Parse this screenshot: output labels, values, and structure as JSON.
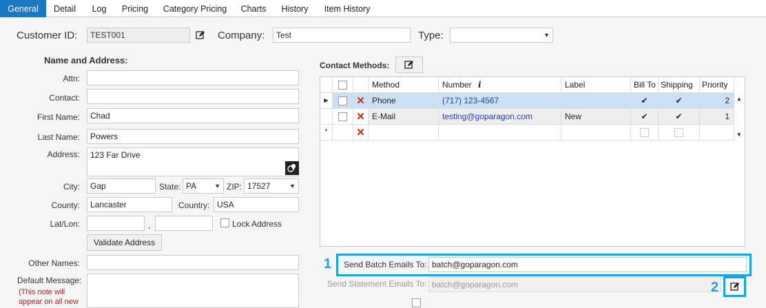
{
  "tabs": [
    "General",
    "Detail",
    "Log",
    "Pricing",
    "Category Pricing",
    "Charts",
    "History",
    "Item History"
  ],
  "header": {
    "customer_id_label": "Customer ID:",
    "customer_id_value": "TEST001",
    "company_label": "Company:",
    "company_value": "Test",
    "type_label": "Type:",
    "type_value": ""
  },
  "address": {
    "section_title": "Name and Address:",
    "attn_label": "Attn:",
    "attn_value": "",
    "contact_label": "Contact:",
    "contact_value": "",
    "first_name_label": "First Name:",
    "first_name_value": "Chad",
    "last_name_label": "Last Name:",
    "last_name_value": "Powers",
    "address_label": "Address:",
    "address_value": "123 Far Drive",
    "city_label": "City:",
    "city_value": "Gap",
    "state_label": "State:",
    "state_value": "PA",
    "zip_label": "ZIP:",
    "zip_value": "17527",
    "county_label": "County:",
    "county_value": "Lancaster",
    "country_label": "Country:",
    "country_value": "USA",
    "latlon_label": "Lat/Lon:",
    "lat_value": "",
    "latlon_separator": ",",
    "lon_value": "",
    "lock_address_label": "Lock Address",
    "validate_button": "Validate Address",
    "other_names_label": "Other Names:",
    "other_names_value": "",
    "default_message_label": "Default Message:",
    "default_message_note": "(This note will",
    "default_message_note2": "appear on all new"
  },
  "contact_methods": {
    "title": "Contact Methods:",
    "columns": [
      "Method",
      "Number",
      "Label",
      "Bill To",
      "Shipping",
      "Priority"
    ],
    "rows": [
      {
        "method": "Phone",
        "number": "(717) 123-4567",
        "label": "",
        "bill_to": true,
        "shipping": true,
        "priority": "2"
      },
      {
        "method": "E-Mail",
        "number": "testing@goparagon.com",
        "label": "New",
        "bill_to": true,
        "shipping": true,
        "priority": "1"
      }
    ],
    "new_row_marker": "*"
  },
  "emails": {
    "batch_label": "Send Batch Emails To:",
    "batch_value": "batch@goparagon.com",
    "statement_label": "Send Statement Emails To:",
    "statement_value": "batch@goparagon.com"
  },
  "callouts": {
    "one": "1",
    "two": "2"
  },
  "colors": {
    "tab_active": "#1a78c2",
    "highlight": "#1aa3e0",
    "selected_row": "#cce0f5",
    "link": "#1a3ccc",
    "delete": "#d9231f"
  }
}
